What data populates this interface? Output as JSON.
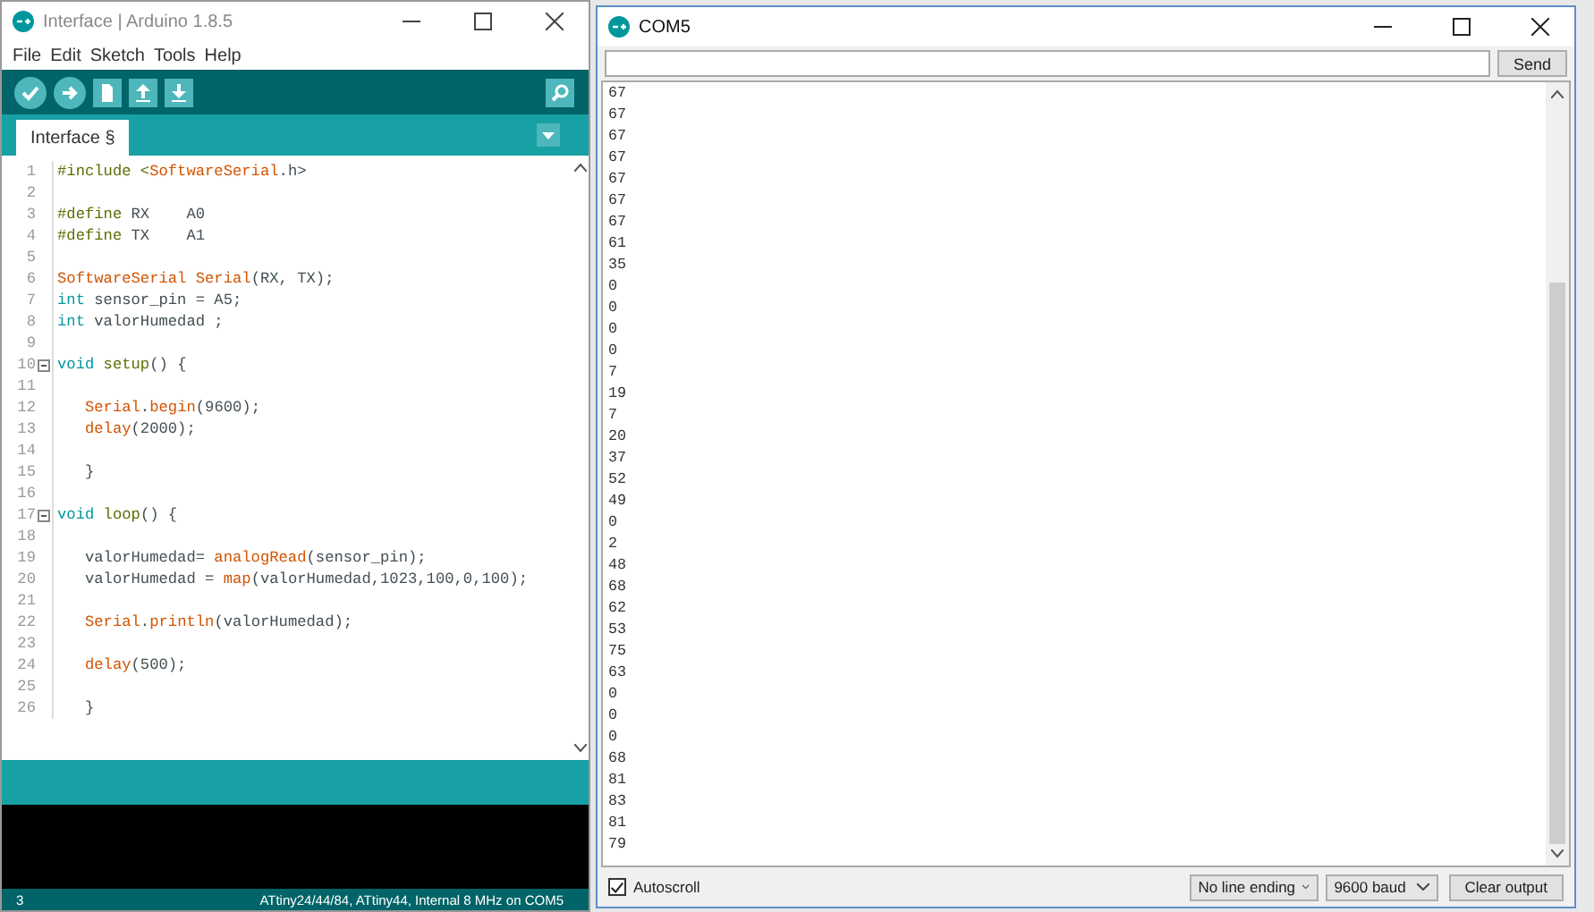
{
  "ide": {
    "title": "Interface | Arduino 1.8.5",
    "menu": [
      "File",
      "Edit",
      "Sketch",
      "Tools",
      "Help"
    ],
    "tabs": [
      {
        "label": "Interface §",
        "selected": true
      }
    ],
    "code_lines": [
      {
        "number": "1",
        "fold": false,
        "tokens": [
          {
            "kind": "directive",
            "text": "#include <"
          },
          {
            "kind": "func",
            "text": "SoftwareSerial"
          },
          {
            "kind": "plain",
            "text": ".h>"
          }
        ]
      },
      {
        "number": "2",
        "fold": false
      },
      {
        "number": "3",
        "fold": false,
        "tokens": [
          {
            "kind": "directive",
            "text": "#define"
          },
          {
            "kind": "plain",
            "text": " RX    A0"
          }
        ]
      },
      {
        "number": "4",
        "fold": false,
        "tokens": [
          {
            "kind": "directive",
            "text": "#define"
          },
          {
            "kind": "plain",
            "text": " TX    A1"
          }
        ]
      },
      {
        "number": "5",
        "fold": false
      },
      {
        "number": "6",
        "fold": false,
        "tokens": [
          {
            "kind": "func",
            "text": "SoftwareSerial Serial"
          },
          {
            "kind": "plain",
            "text": "(RX, TX);"
          }
        ]
      },
      {
        "number": "7",
        "fold": false,
        "tokens": [
          {
            "kind": "type",
            "text": "int"
          },
          {
            "kind": "plain",
            "text": " sensor_pin = A5;"
          }
        ]
      },
      {
        "number": "8",
        "fold": false,
        "tokens": [
          {
            "kind": "type",
            "text": "int"
          },
          {
            "kind": "plain",
            "text": " valorHumedad ;"
          }
        ]
      },
      {
        "number": "9",
        "fold": false
      },
      {
        "number": "10",
        "fold": true,
        "tokens": [
          {
            "kind": "type",
            "text": "void "
          },
          {
            "kind": "directive",
            "text": "setup"
          },
          {
            "kind": "plain",
            "text": "() {"
          }
        ]
      },
      {
        "number": "11",
        "fold": false
      },
      {
        "number": "12",
        "fold": false,
        "tokens": [
          {
            "kind": "func",
            "text": "   Serial"
          },
          {
            "kind": "plain",
            "text": "."
          },
          {
            "kind": "func",
            "text": "begin"
          },
          {
            "kind": "plain",
            "text": "(9600);"
          }
        ]
      },
      {
        "number": "13",
        "fold": false,
        "tokens": [
          {
            "kind": "func",
            "text": "   delay"
          },
          {
            "kind": "plain",
            "text": "(2000);"
          }
        ]
      },
      {
        "number": "14",
        "fold": false
      },
      {
        "number": "15",
        "fold": false,
        "tokens": [
          {
            "kind": "plain",
            "text": "   }"
          }
        ]
      },
      {
        "number": "16",
        "fold": false
      },
      {
        "number": "17",
        "fold": true,
        "tokens": [
          {
            "kind": "type",
            "text": "void "
          },
          {
            "kind": "directive",
            "text": "loop"
          },
          {
            "kind": "plain",
            "text": "() {"
          }
        ]
      },
      {
        "number": "18",
        "fold": false
      },
      {
        "number": "19",
        "fold": false,
        "tokens": [
          {
            "kind": "plain",
            "text": "   valorHumedad= "
          },
          {
            "kind": "func",
            "text": "analogRead"
          },
          {
            "kind": "plain",
            "text": "(sensor_pin);"
          }
        ]
      },
      {
        "number": "20",
        "fold": false,
        "tokens": [
          {
            "kind": "plain",
            "text": "   valorHumedad = "
          },
          {
            "kind": "func",
            "text": "map"
          },
          {
            "kind": "plain",
            "text": "(valorHumedad,1023,100,0,100);"
          }
        ]
      },
      {
        "number": "21",
        "fold": false
      },
      {
        "number": "22",
        "fold": false,
        "tokens": [
          {
            "kind": "func",
            "text": "   Serial"
          },
          {
            "kind": "plain",
            "text": "."
          },
          {
            "kind": "func",
            "text": "println"
          },
          {
            "kind": "plain",
            "text": "(valorHumedad);"
          }
        ]
      },
      {
        "number": "23",
        "fold": false
      },
      {
        "number": "24",
        "fold": false,
        "tokens": [
          {
            "kind": "func",
            "text": "   delay"
          },
          {
            "kind": "plain",
            "text": "(500);"
          }
        ]
      },
      {
        "number": "25",
        "fold": false
      },
      {
        "number": "26",
        "fold": false,
        "tokens": [
          {
            "kind": "plain",
            "text": "   }"
          }
        ]
      }
    ],
    "status_bar": {
      "line": "3",
      "board": "ATtiny24/44/84, ATtiny44, Internal 8 MHz on COM5"
    }
  },
  "serial_monitor": {
    "title": "COM5",
    "send_button": "Send",
    "output": [
      "67",
      "67",
      "67",
      "67",
      "67",
      "67",
      "67",
      "61",
      "35",
      "0",
      "0",
      "0",
      "0",
      "7",
      "19",
      "7",
      "20",
      "37",
      "52",
      "49",
      "0",
      "2",
      "48",
      "68",
      "62",
      "53",
      "75",
      "63",
      "0",
      "0",
      "0",
      "68",
      "81",
      "83",
      "81",
      "79"
    ],
    "autoscroll": {
      "label": "Autoscroll",
      "checked": true
    },
    "line_ending": "No line ending",
    "baud": "9600 baud",
    "clear_button": "Clear output"
  }
}
